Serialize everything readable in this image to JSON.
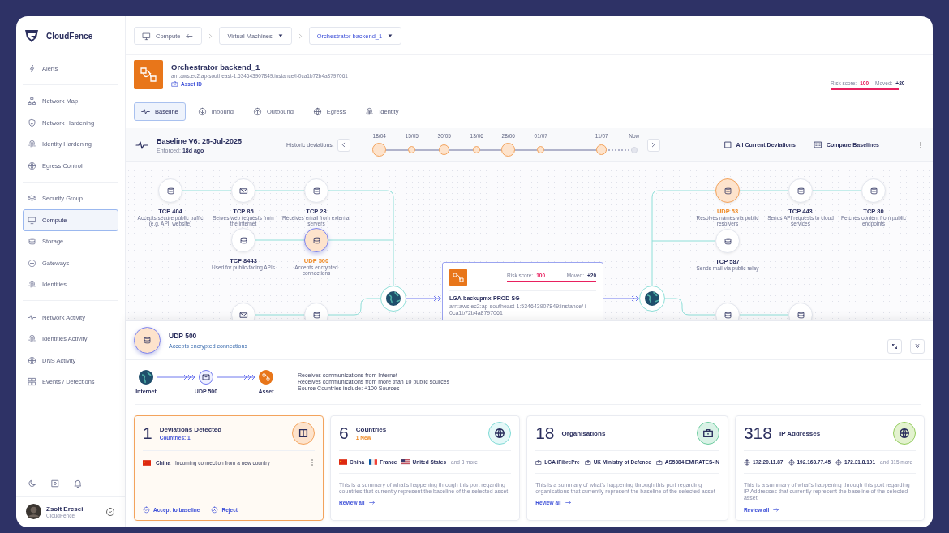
{
  "brand": {
    "name": "CloudFence"
  },
  "sidebar": {
    "groups": [
      [
        {
          "label": "Alerts",
          "selected": false
        }
      ],
      [
        {
          "label": "Network Map",
          "selected": false
        },
        {
          "label": "Network Hardening",
          "selected": false
        },
        {
          "label": "Identity Hardening",
          "selected": false
        },
        {
          "label": "Egress Control",
          "selected": false
        }
      ],
      [
        {
          "label": "Security Group",
          "selected": false
        },
        {
          "label": "Compute",
          "selected": true
        },
        {
          "label": "Storage",
          "selected": false
        },
        {
          "label": "Gateways",
          "selected": false
        },
        {
          "label": "Identities",
          "selected": false
        }
      ],
      [
        {
          "label": "Network Activity",
          "selected": false
        },
        {
          "label": "Identities Activity",
          "selected": false
        },
        {
          "label": "DNS Activity",
          "selected": false
        },
        {
          "label": "Events / Detections",
          "selected": false
        }
      ]
    ],
    "user": {
      "name": "Zsolt Ercsei",
      "org": "CloudFence"
    }
  },
  "breadcrumbs": [
    {
      "label": "Compute",
      "kind": "back",
      "selected": false
    },
    {
      "label": "Virtual Machines",
      "kind": "dropdown",
      "selected": false
    },
    {
      "label": "Orchestrator backend_1",
      "kind": "dropdown",
      "selected": true
    }
  ],
  "asset": {
    "name": "Orchestrator backend_1",
    "arn": "arn:aws:ec2:ap-southeast-1:534643907849:instance/i-0ca1b72b4a8797061",
    "id_link": "Asset ID",
    "risk_label": "Risk score:",
    "risk_value": "100",
    "moved_label": "Moved:",
    "moved_value": "+20"
  },
  "tabs": [
    {
      "label": "Baseline",
      "selected": true
    },
    {
      "label": "Inbound",
      "selected": false
    },
    {
      "label": "Outbound",
      "selected": false
    },
    {
      "label": "Egress",
      "selected": false
    },
    {
      "label": "Identity",
      "selected": false
    }
  ],
  "baseline": {
    "title": "Baseline V6: 25-Jul-2025",
    "enforced_label": "Enforced:",
    "enforced_value": "18d ago",
    "historic_label": "Historic deviations:",
    "timeline": [
      {
        "date": "18/04",
        "kind": "large"
      },
      {
        "date": "15/05",
        "kind": "small"
      },
      {
        "date": "30/05",
        "kind": "medium"
      },
      {
        "date": "13/06",
        "kind": "small"
      },
      {
        "date": "28/06",
        "kind": "large"
      },
      {
        "date": "01/07",
        "kind": "small"
      },
      {
        "date": "11/07",
        "kind": "medium"
      },
      {
        "date": "Now",
        "kind": "now"
      }
    ],
    "actions": [
      {
        "label": "All Current Deviations"
      },
      {
        "label": "Compare Baselines"
      }
    ]
  },
  "graph": {
    "inbound": [
      {
        "kind": "db",
        "port": "TCP 404",
        "description": "Accepts secure public traffic (e.g. API, website)",
        "deviation": false,
        "selected": false
      },
      {
        "kind": "mail",
        "port": "TCP 85",
        "description": "Serves web requests from the internet",
        "deviation": false,
        "selected": false
      },
      {
        "kind": "db",
        "port": "TCP 23",
        "description": "Receives email from external servers",
        "deviation": false,
        "selected": false
      },
      {
        "kind": "db",
        "port": "TCP 8443",
        "description": "Used for public-facing APIs",
        "deviation": false,
        "selected": false
      },
      {
        "kind": "db",
        "port": "UDP 500",
        "description": "Accepts encrypted connections",
        "deviation": true,
        "selected": true
      },
      {
        "kind": "mail",
        "deviation": false,
        "selected": false
      },
      {
        "kind": "db",
        "deviation": false,
        "selected": false
      }
    ],
    "outbound": [
      {
        "kind": "db",
        "port": "UDP 53",
        "description": "Resolves names via public resolvers",
        "deviation": true,
        "selected": false
      },
      {
        "kind": "db",
        "port": "TCP 443",
        "description": "Sends API requests to cloud services",
        "deviation": false,
        "selected": false
      },
      {
        "kind": "db",
        "port": "TCP 80",
        "description": "Fetches content from public endpoints",
        "deviation": false,
        "selected": false
      },
      {
        "kind": "db",
        "port": "TCP 587",
        "description": "Sends mail via public relay",
        "deviation": false,
        "selected": false
      },
      {
        "kind": "db",
        "deviation": false,
        "selected": false
      },
      {
        "kind": "db",
        "deviation": false,
        "selected": false
      }
    ],
    "asset": {
      "risk_label": "Risk score:",
      "risk_value": "100",
      "moved_label": "Moved:",
      "moved_value": "+20",
      "name": "LGA-backupmx-PROD-SG",
      "arn": "arn:aws:ec2:ap-southeast-1:534643907849:instance/ i-0ca1b72b4a8797061"
    }
  },
  "detail": {
    "port": "UDP 500",
    "description": "Accepts encrypted connections",
    "flow": [
      {
        "label": "Internet",
        "kind": "internet"
      },
      {
        "label": "UDP 500",
        "kind": "port"
      },
      {
        "label": "Asset",
        "kind": "asset"
      }
    ],
    "notes": [
      "Receives communications from Internet",
      "Receives communications from more than 10 public sources",
      "Source Countries include: +100 Sources"
    ],
    "cards": [
      {
        "kind": "deviations",
        "count": "1",
        "title": "Deviations Detected",
        "subtitle": "Countries: 1",
        "deviation": {
          "kind": "cn",
          "country": "China",
          "text": "Incoming connection from a new country"
        },
        "actions": [
          "Accept to baseline",
          "Reject"
        ]
      },
      {
        "kind": "countries",
        "count": "6",
        "title": "Countries",
        "subtitle": "1 New",
        "items": [
          {
            "kind": "cn",
            "label": "China"
          },
          {
            "kind": "fr",
            "label": "France"
          },
          {
            "kind": "us",
            "label": "United States"
          }
        ],
        "more": "and 3 more",
        "summary": "This is a summary of what's happening through this port regarding countries that currently represent the baseline of the selected asset",
        "link": "Review all"
      },
      {
        "kind": "organisations",
        "count": "18",
        "title": "Organisations",
        "items": [
          {
            "label": "LGA iFibrePre"
          },
          {
            "label": "UK Ministry of Defence"
          },
          {
            "label": "AS5384 EMIRATES-IN"
          }
        ],
        "summary": "This is a summary of what's happening through this port regarding organisations that currently represent the baseline of the selected asset",
        "link": "Review all"
      },
      {
        "kind": "ips",
        "count": "318",
        "title": "IP Addresses",
        "items": [
          {
            "label": "172.20.11.87"
          },
          {
            "label": "192.168.77.45"
          },
          {
            "label": "172.31.8.101"
          }
        ],
        "more": "and 315 more",
        "summary": "This is a summary of what's happening through this port regarding IP Addresses that currently represent the baseline of the selected asset",
        "link": "Review all"
      }
    ]
  }
}
